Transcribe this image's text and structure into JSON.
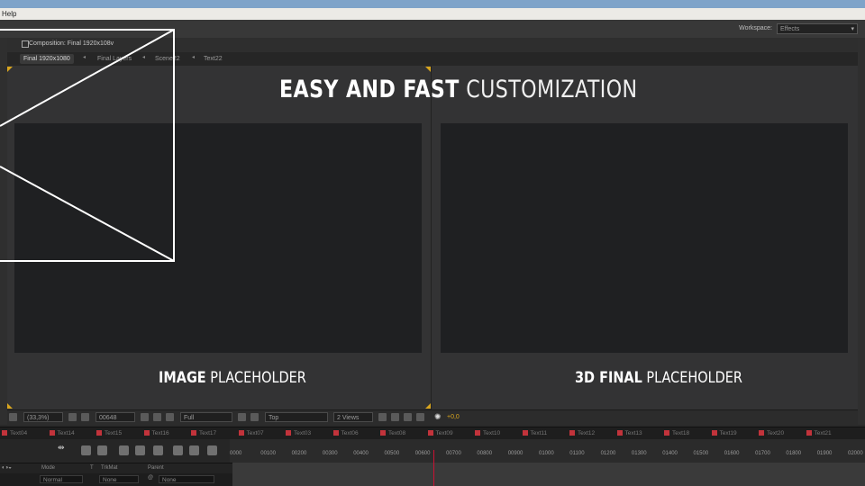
{
  "menubar": {
    "help": "Help"
  },
  "toolbar": {
    "workspace_label": "Workspace:",
    "workspace_value": "Effects"
  },
  "composition": {
    "title": "Composition: Final 1920x108v",
    "tabs": [
      "Final 1920x1080",
      "Final Layers",
      "Scene22",
      "Text22"
    ]
  },
  "canvas": {
    "headline_bold": "EASY AND FAST",
    "headline_light": "CUSTOMIZATION",
    "left_caption_bold": "IMAGE",
    "left_caption_light": "PLACEHOLDER",
    "right_caption_bold": "3D FINAL",
    "right_caption_light": "PLACEHOLDER"
  },
  "viewer_controls": {
    "zoom": "(33,3%)",
    "timecode": "00648",
    "resolution": "Full",
    "view": "Top",
    "views": "2 Views",
    "exposure": "+0,0"
  },
  "timeline": {
    "tabs": [
      "Text04",
      "Text14",
      "Text15",
      "Text16",
      "Text17",
      "Text07",
      "Text03",
      "Text06",
      "Text08",
      "Text09",
      "Text10",
      "Text11",
      "Text12",
      "Text13",
      "Text18",
      "Text19",
      "Text20",
      "Text21"
    ],
    "ticks": [
      "0000",
      "00100",
      "00200",
      "00300",
      "00400",
      "00500",
      "00600",
      "00700",
      "00800",
      "00900",
      "01000",
      "01100",
      "01200",
      "01300",
      "01400",
      "01500",
      "01600",
      "01700",
      "01800",
      "01900",
      "02000"
    ],
    "columns": {
      "mode": "Mode",
      "trkmat": "TrkMat",
      "parent": "Parent"
    },
    "row": {
      "mode": "Normal",
      "trkmat": "None",
      "parent": "None"
    }
  },
  "colors": {
    "tab_marker": "#c2333b",
    "accent_yellow": "#d8a51e"
  }
}
